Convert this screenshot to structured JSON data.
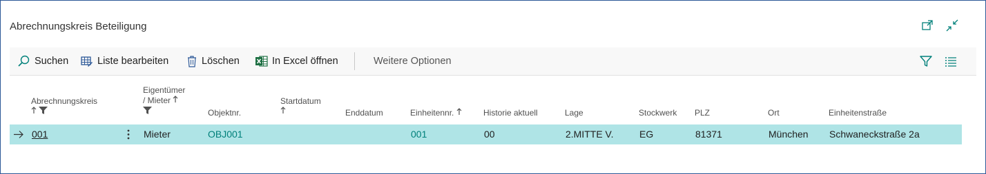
{
  "page": {
    "title": "Abrechnungskreis Beteiligung"
  },
  "window_icons": [
    "open-in-new-window-icon",
    "collapse-icon"
  ],
  "toolbar": {
    "search_label": "Suchen",
    "edit_list_label": "Liste bearbeiten",
    "delete_label": "Löschen",
    "excel_label": "In Excel öffnen",
    "more_options_label": "Weitere Optionen"
  },
  "columns": {
    "abrechnungskreis": "Abrechnungskreis",
    "eigentuemer_line1": "Eigentümer",
    "eigentuemer_line2": "/ Mieter",
    "objektnr": "Objektnr.",
    "startdatum": "Startdatum",
    "enddatum": "Enddatum",
    "einheitennr": "Einheitennr.",
    "historie": "Historie aktuell",
    "lage": "Lage",
    "stockwerk": "Stockwerk",
    "plz": "PLZ",
    "ort": "Ort",
    "einheitenstrasse": "Einheitenstraße"
  },
  "rows": [
    {
      "abrechnungskreis": "001",
      "eigentuemer_mieter": "Mieter",
      "objektnr": "OBJ001",
      "startdatum": "",
      "enddatum": "",
      "einheitennr": "001",
      "historie": "00",
      "lage": "2.MITTE V.",
      "stockwerk": "EG",
      "plz": "81371",
      "ort": "München",
      "einheitenstrasse": "Schwaneckstraße 2a"
    }
  ],
  "colors": {
    "accent": "#00807a",
    "selected_row": "#afe4e6",
    "border": "#2b5797"
  }
}
